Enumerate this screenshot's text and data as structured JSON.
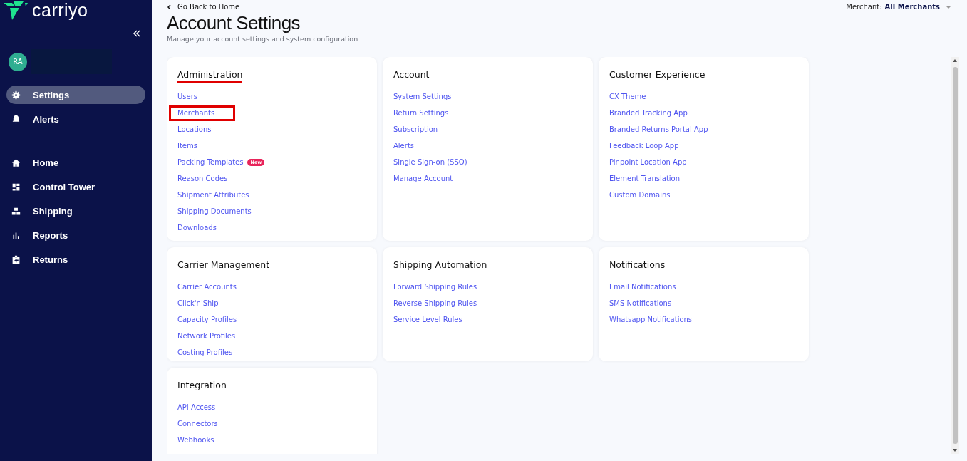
{
  "sidebar": {
    "logo": "carriyo",
    "user": {
      "initials": "RA"
    },
    "top_items": [
      {
        "label": "Settings",
        "selected": true
      },
      {
        "label": "Alerts",
        "selected": false
      }
    ],
    "items": [
      {
        "label": "Home",
        "selected": false
      },
      {
        "label": "Control Tower",
        "selected": false
      },
      {
        "label": "Shipping",
        "selected": false
      },
      {
        "label": "Reports",
        "selected": false
      },
      {
        "label": "Returns",
        "selected": false
      }
    ]
  },
  "header": {
    "back_link": "Go Back to Home",
    "title": "Account Settings",
    "subtitle": "Manage your account settings and system configuration.",
    "merchant_label": "Merchant:",
    "merchant_value": "All Merchants"
  },
  "cards": [
    {
      "title": "Administration",
      "title_marked": true,
      "links": [
        {
          "label": "Users",
          "highlighted": false
        },
        {
          "label": "Merchants",
          "highlighted": true
        },
        {
          "label": "Locations",
          "highlighted": false
        },
        {
          "label": "Items",
          "highlighted": false
        },
        {
          "label": "Packing Templates",
          "badge": "New",
          "highlighted": false
        },
        {
          "label": "Reason Codes",
          "highlighted": false
        },
        {
          "label": "Shipment Attributes",
          "highlighted": false
        },
        {
          "label": "Shipping Documents",
          "highlighted": false
        },
        {
          "label": "Downloads",
          "highlighted": false
        }
      ]
    },
    {
      "title": "Account",
      "title_marked": false,
      "links": [
        {
          "label": "System Settings",
          "highlighted": false
        },
        {
          "label": "Return Settings",
          "highlighted": false
        },
        {
          "label": "Subscription",
          "highlighted": false
        },
        {
          "label": "Alerts",
          "highlighted": false
        },
        {
          "label": "Single Sign-on (SSO)",
          "highlighted": false
        },
        {
          "label": "Manage Account",
          "highlighted": false
        }
      ]
    },
    {
      "title": "Customer Experience",
      "title_marked": false,
      "links": [
        {
          "label": "CX Theme",
          "highlighted": false
        },
        {
          "label": "Branded Tracking App",
          "highlighted": false
        },
        {
          "label": "Branded Returns Portal App",
          "highlighted": false
        },
        {
          "label": "Feedback Loop App",
          "highlighted": false
        },
        {
          "label": "Pinpoint Location App",
          "highlighted": false
        },
        {
          "label": "Element Translation",
          "highlighted": false
        },
        {
          "label": "Custom Domains",
          "highlighted": false
        }
      ]
    },
    {
      "title": "Carrier Management",
      "title_marked": false,
      "links": [
        {
          "label": "Carrier Accounts",
          "highlighted": false
        },
        {
          "label": "Click'n'Ship",
          "highlighted": false
        },
        {
          "label": "Capacity Profiles",
          "highlighted": false
        },
        {
          "label": "Network Profiles",
          "highlighted": false
        },
        {
          "label": "Costing Profiles",
          "highlighted": false
        }
      ]
    },
    {
      "title": "Shipping Automation",
      "title_marked": false,
      "links": [
        {
          "label": "Forward Shipping Rules",
          "highlighted": false
        },
        {
          "label": "Reverse Shipping Rules",
          "highlighted": false
        },
        {
          "label": "Service Level Rules",
          "highlighted": false
        }
      ]
    },
    {
      "title": "Notifications",
      "title_marked": false,
      "links": [
        {
          "label": "Email Notifications",
          "highlighted": false
        },
        {
          "label": "SMS Notifications",
          "highlighted": false
        },
        {
          "label": "Whatsapp Notifications",
          "highlighted": false
        }
      ]
    },
    {
      "title": "Integration",
      "title_marked": false,
      "links": [
        {
          "label": "API Access",
          "highlighted": false
        },
        {
          "label": "Connectors",
          "highlighted": false
        },
        {
          "label": "Webhooks",
          "highlighted": false
        }
      ]
    }
  ]
}
